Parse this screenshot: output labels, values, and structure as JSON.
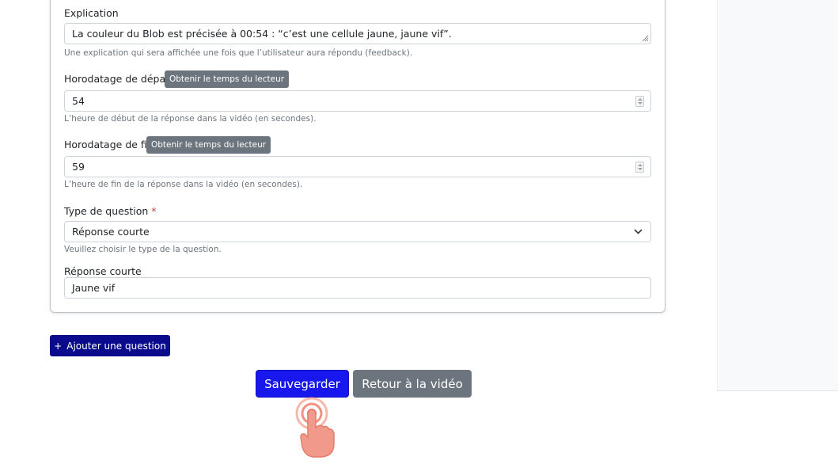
{
  "form": {
    "explanation": {
      "label": "Explication",
      "value": "La couleur du Blob est précisée à 00:54 : “c’est une cellule jaune, jaune vif”.",
      "help": "Une explication qui sera affichée une fois que l’utilisateur aura répondu (feedback)."
    },
    "start_time": {
      "label": "Horodatage de départ",
      "button": "Obtenir le temps du lecteur",
      "value": "54",
      "help": "L’heure de début de la réponse dans la vidéo (en secondes)."
    },
    "end_time": {
      "label": "Horodatage de fin",
      "button": "Obtenir le temps du lecteur",
      "value": "59",
      "help": "L’heure de fin de la réponse dans la vidéo (en secondes)."
    },
    "question_type": {
      "label": "Type de question",
      "required_mark": "*",
      "selected": "Réponse courte",
      "help": "Veuillez choisir le type de la question."
    },
    "short_answer": {
      "label": "Réponse courte",
      "value": "Jaune vif"
    }
  },
  "actions": {
    "add_question_icon": "+",
    "add_question": "Ajouter une question",
    "save": "Sauvegarder",
    "back": "Retour à la vidéo"
  },
  "icons": {
    "spinner": "spinner-icon",
    "chevron": "chevron-down-icon",
    "resize": "resize-handle-icon",
    "cursor": "tap-cursor-icon"
  },
  "colors": {
    "primary": "#1818ee",
    "add_button": "#0a0a8c",
    "secondary": "#6c757d",
    "required": "#dc3545"
  }
}
